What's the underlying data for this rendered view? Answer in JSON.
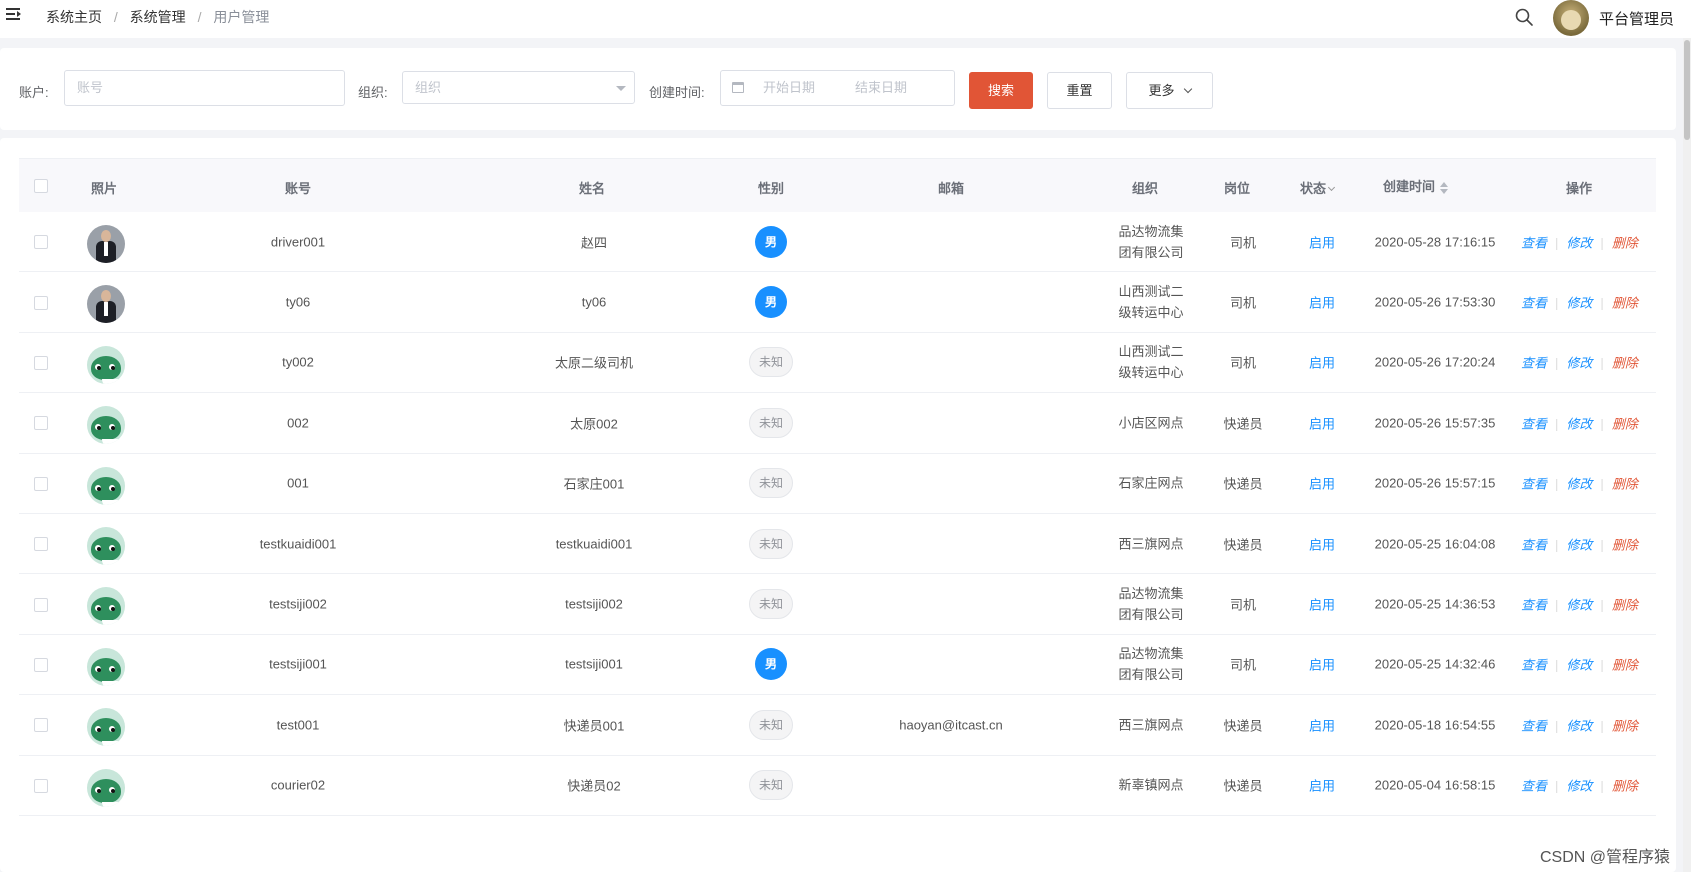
{
  "header": {
    "breadcrumb": [
      "系统主页",
      "系统管理",
      "用户管理"
    ],
    "breadcrumb_sep": "/",
    "user_name": "平台管理员"
  },
  "filters": {
    "account_label": "账户:",
    "account_placeholder": "账号",
    "org_label": "组织:",
    "org_placeholder": "组织",
    "created_label": "创建时间:",
    "start_placeholder": "开始日期",
    "end_placeholder": "结束日期",
    "search_label": "搜索",
    "reset_label": "重置",
    "more_label": "更多"
  },
  "table": {
    "headers": {
      "photo": "照片",
      "account": "账号",
      "name": "姓名",
      "gender": "性别",
      "email": "邮箱",
      "org": "组织",
      "post": "岗位",
      "status": "状态",
      "created": "创建时间",
      "actions": "操作"
    },
    "action_labels": {
      "view": "查看",
      "edit": "修改",
      "delete": "删除",
      "sep": "|"
    },
    "rows": [
      {
        "photo": "person",
        "account": "driver001",
        "name": "赵四",
        "gender": "男",
        "gender_type": "male",
        "email": "",
        "org": "品达物流集团有限公司",
        "post": "司机",
        "status": "启用",
        "created": "2020-05-28 17:16:15"
      },
      {
        "photo": "person",
        "account": "ty06",
        "name": "ty06",
        "gender": "男",
        "gender_type": "male",
        "email": "",
        "org": "山西测试二级转运中心",
        "post": "司机",
        "status": "启用",
        "created": "2020-05-26 17:53:30"
      },
      {
        "photo": "frog",
        "account": "ty002",
        "name": "太原二级司机",
        "gender": "未知",
        "gender_type": "unknown",
        "email": "",
        "org": "山西测试二级转运中心",
        "post": "司机",
        "status": "启用",
        "created": "2020-05-26 17:20:24"
      },
      {
        "photo": "frog",
        "account": "002",
        "name": "太原002",
        "gender": "未知",
        "gender_type": "unknown",
        "email": "",
        "org": "小店区网点",
        "post": "快递员",
        "status": "启用",
        "created": "2020-05-26 15:57:35"
      },
      {
        "photo": "frog",
        "account": "001",
        "name": "石家庄001",
        "gender": "未知",
        "gender_type": "unknown",
        "email": "",
        "org": "石家庄网点",
        "post": "快递员",
        "status": "启用",
        "created": "2020-05-26 15:57:15"
      },
      {
        "photo": "frog",
        "account": "testkuaidi001",
        "name": "testkuaidi001",
        "gender": "未知",
        "gender_type": "unknown",
        "email": "",
        "org": "西三旗网点",
        "post": "快递员",
        "status": "启用",
        "created": "2020-05-25 16:04:08"
      },
      {
        "photo": "frog",
        "account": "testsiji002",
        "name": "testsiji002",
        "gender": "未知",
        "gender_type": "unknown",
        "email": "",
        "org": "品达物流集团有限公司",
        "post": "司机",
        "status": "启用",
        "created": "2020-05-25 14:36:53"
      },
      {
        "photo": "frog",
        "account": "testsiji001",
        "name": "testsiji001",
        "gender": "男",
        "gender_type": "male",
        "email": "",
        "org": "品达物流集团有限公司",
        "post": "司机",
        "status": "启用",
        "created": "2020-05-25 14:32:46"
      },
      {
        "photo": "frog",
        "account": "test001",
        "name": "快递员001",
        "gender": "未知",
        "gender_type": "unknown",
        "email": "haoyan@itcast.cn",
        "org": "西三旗网点",
        "post": "快递员",
        "status": "启用",
        "created": "2020-05-18 16:54:55"
      },
      {
        "photo": "frog",
        "account": "courier02",
        "name": "快递员02",
        "gender": "未知",
        "gender_type": "unknown",
        "email": "",
        "org": "新辜镇网点",
        "post": "快递员",
        "status": "启用",
        "created": "2020-05-04 16:58:15"
      }
    ]
  },
  "watermark": "CSDN @管程序猿",
  "colors": {
    "primary": "#e15536",
    "link": "#1890ff",
    "male_badge": "#1890ff"
  },
  "icons": {
    "menu": "menu-fold-icon",
    "search": "search-icon",
    "calendar": "calendar-icon",
    "select": "caret-down-icon"
  }
}
